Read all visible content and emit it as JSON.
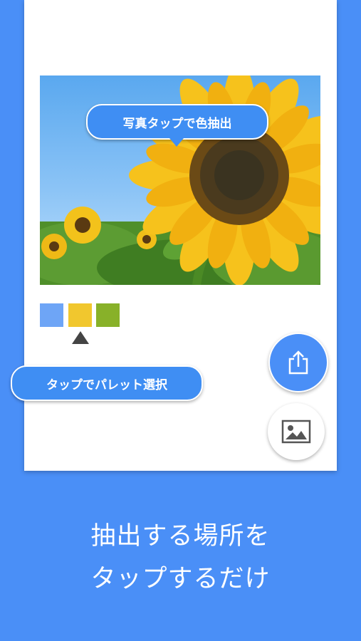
{
  "tooltips": {
    "photo_tap": "写真タップで色抽出",
    "palette_tap": "タップでパレット選択"
  },
  "palette": {
    "swatches": [
      "#6ea5f6",
      "#f1c72e",
      "#88b129"
    ],
    "selected_index": 1
  },
  "buttons": {
    "share_icon": "share-icon",
    "image_icon": "image-icon"
  },
  "caption": {
    "line1": "抽出する場所を",
    "line2": "タップするだけ"
  },
  "colors": {
    "background": "#4a8ff7",
    "accent": "#3f8ef3"
  }
}
